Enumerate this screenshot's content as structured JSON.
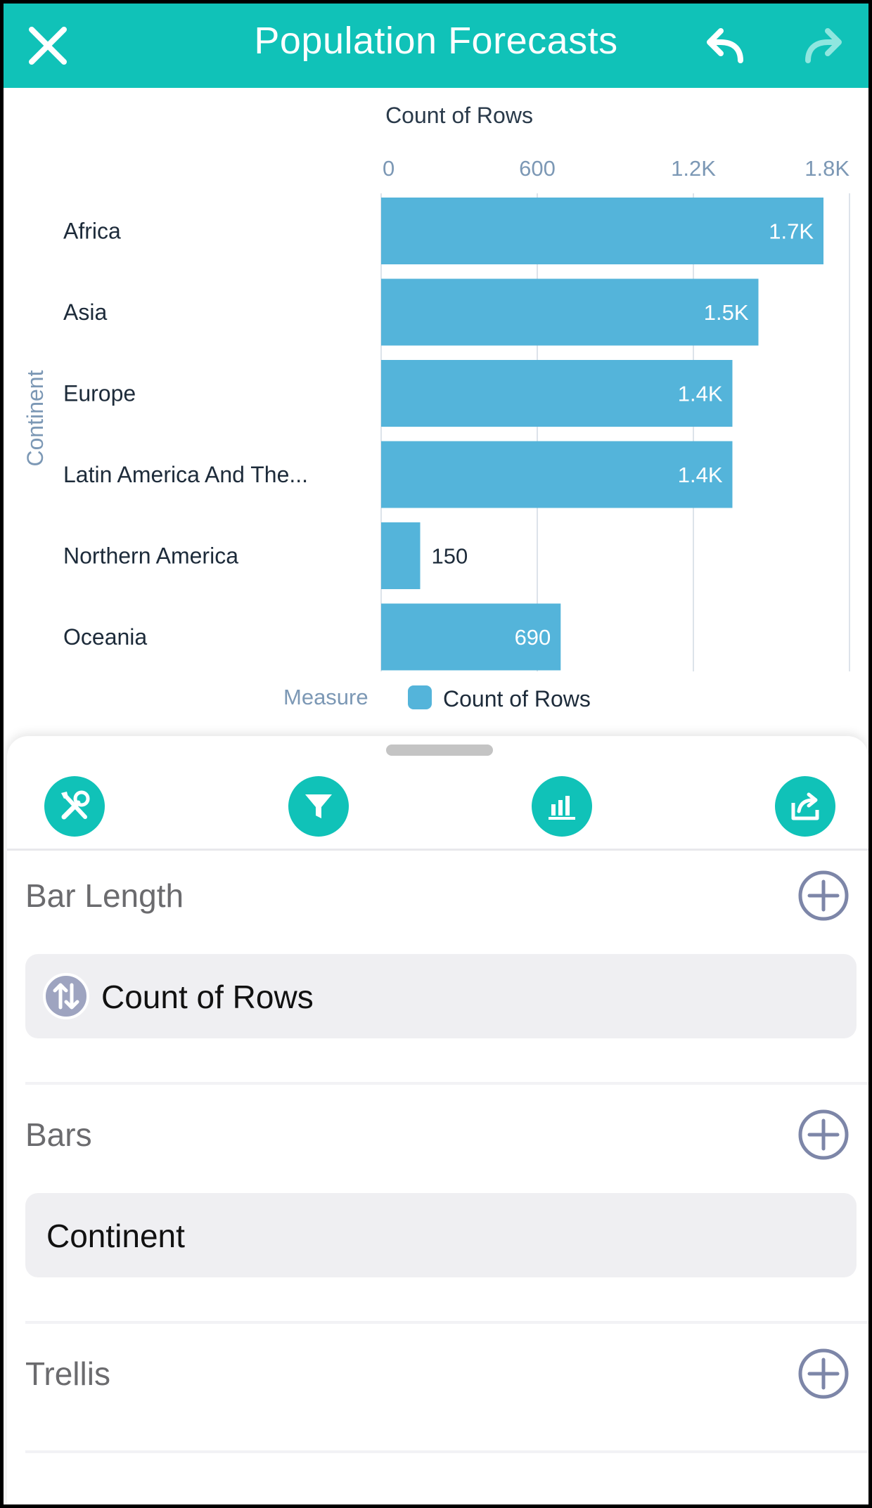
{
  "header": {
    "title": "Population Forecasts",
    "close_icon": "close-icon",
    "undo_icon": "undo-icon",
    "redo_icon": "redo-icon",
    "bg_color": "#10c2b8"
  },
  "chart_data": {
    "type": "bar",
    "orientation": "horizontal",
    "title": "Count of Rows",
    "ylabel": "Continent",
    "categories": [
      "Africa",
      "Asia",
      "Europe",
      "Latin America And The...",
      "Northern America",
      "Oceania"
    ],
    "values": [
      1700,
      1450,
      1350,
      1350,
      150,
      690
    ],
    "value_labels": [
      "1.7K",
      "1.5K",
      "1.4K",
      "1.4K",
      "150",
      "690"
    ],
    "xlim": [
      0,
      1800
    ],
    "xticks": [
      0,
      600,
      1200,
      1800
    ],
    "xtick_labels": [
      "0",
      "600",
      "1.2K",
      "1.8K"
    ],
    "grid": true,
    "legend_title": "Measure",
    "legend": [
      {
        "name": "Count of Rows",
        "color": "#54b4da"
      }
    ],
    "bar_color": "#54b4da"
  },
  "toolbar": {
    "buttons": [
      "tools-icon",
      "filter-icon",
      "bar-chart-icon",
      "share-icon"
    ]
  },
  "sections": {
    "bar_length": {
      "label": "Bar Length",
      "item": "Count of Rows",
      "item_icon": "sort-arrows-icon"
    },
    "bars": {
      "label": "Bars",
      "item": "Continent"
    },
    "trellis": {
      "label": "Trellis"
    }
  }
}
